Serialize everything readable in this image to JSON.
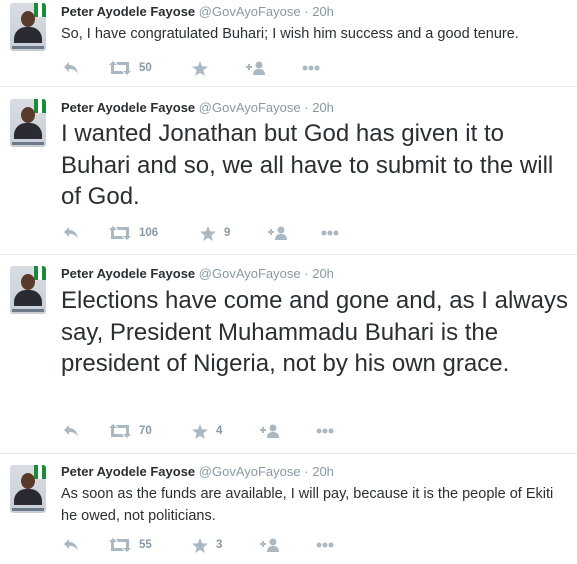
{
  "tweets": [
    {
      "name": "Peter Ayodele Fayose",
      "handle": "@GovAyoFayose",
      "dot": "·",
      "time": "20h",
      "text": "So, I have congratulated Buhari; I wish him success and a good tenure.",
      "retweets": "50",
      "favorites": ""
    },
    {
      "name": "Peter Ayodele Fayose",
      "handle": "@GovAyoFayose",
      "dot": "·",
      "time": "20h",
      "text": "I wanted Jonathan but God has given it to Buhari and so, we all have to submit to the will of God.",
      "retweets": "106",
      "favorites": "9"
    },
    {
      "name": "Peter Ayodele Fayose",
      "handle": "@GovAyoFayose",
      "dot": "·",
      "time": "20h",
      "text": "Elections have come and gone and, as I always say, President Muhammadu Buhari is the president of Nigeria, not by his own grace.",
      "retweets": "70",
      "favorites": "4"
    },
    {
      "name": "Peter Ayodele Fayose",
      "handle": "@GovAyoFayose",
      "dot": "·",
      "time": "20h",
      "text": "As soon as the funds are available, I will pay, because it is the people of Ekiti he owed, not politicians.",
      "retweets": "55",
      "favorites": "3"
    }
  ],
  "icons": {
    "reply": "reply-icon",
    "retweet": "retweet-icon",
    "favorite": "star-icon",
    "follow": "follow-icon",
    "more": "more-icon"
  },
  "colors": {
    "icon": "#aab8c2",
    "meta": "#8899a6",
    "text": "#292f33",
    "divider": "#e1e8ed"
  }
}
